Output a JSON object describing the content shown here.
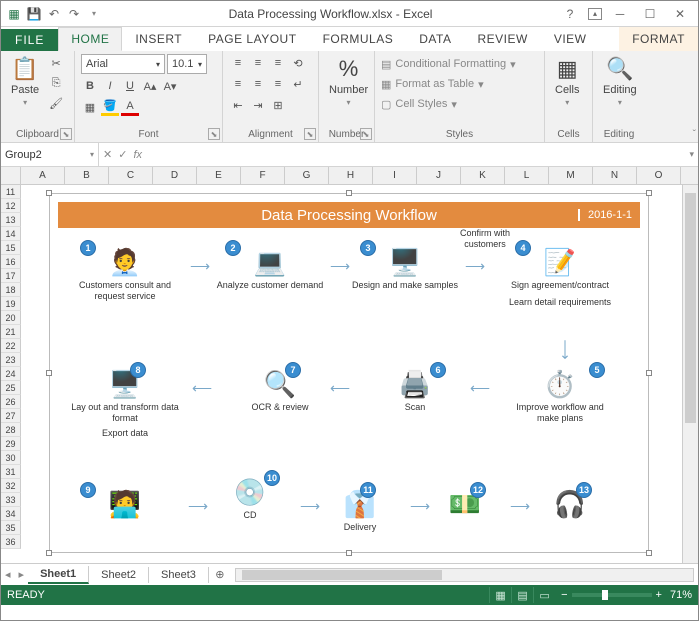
{
  "title": "Data Processing Workflow.xlsx - Excel",
  "tabs": {
    "file": "FILE",
    "home": "HOME",
    "insert": "INSERT",
    "page": "PAGE LAYOUT",
    "formulas": "FORMULAS",
    "data": "DATA",
    "review": "REVIEW",
    "view": "VIEW",
    "format": "FORMAT"
  },
  "ribbon": {
    "clipboard": {
      "label": "Clipboard",
      "paste": "Paste"
    },
    "font": {
      "label": "Font",
      "name": "Arial",
      "size": "10.1"
    },
    "alignment": {
      "label": "Alignment"
    },
    "number": {
      "label": "Number",
      "btn": "Number"
    },
    "styles": {
      "label": "Styles",
      "cond": "Conditional Formatting",
      "table": "Format as Table",
      "cell": "Cell Styles"
    },
    "cells": {
      "label": "Cells",
      "btn": "Cells"
    },
    "editing": {
      "label": "Editing",
      "btn": "Editing"
    }
  },
  "namebox": "Group2",
  "columns": [
    "A",
    "B",
    "C",
    "D",
    "E",
    "F",
    "G",
    "H",
    "I",
    "J",
    "K",
    "L",
    "M",
    "N",
    "O"
  ],
  "rows": [
    11,
    12,
    13,
    14,
    15,
    16,
    17,
    18,
    19,
    20,
    21,
    22,
    23,
    24,
    25,
    26,
    27,
    28,
    29,
    30,
    31,
    32,
    33,
    34,
    35,
    36
  ],
  "diagram": {
    "title": "Data Processing Workflow",
    "date": "2016-1-1",
    "nodes": {
      "n1": "Customers consult and request service",
      "n2": "Analyze customer demand",
      "n3": "Design and make samples",
      "n3b": "Confirm with customers",
      "n4": "Sign agreement/contract",
      "n4b": "Learn detail requirements",
      "n5": "Improve workflow and make plans",
      "n6": "Scan",
      "n7": "OCR & review",
      "n8": "Lay out and transform data  format",
      "n8b": "Export data",
      "n10": "CD",
      "n11": "Delivery"
    }
  },
  "sheets": {
    "s1": "Sheet1",
    "s2": "Sheet2",
    "s3": "Sheet3"
  },
  "status": {
    "ready": "READY",
    "zoom": "71%"
  }
}
